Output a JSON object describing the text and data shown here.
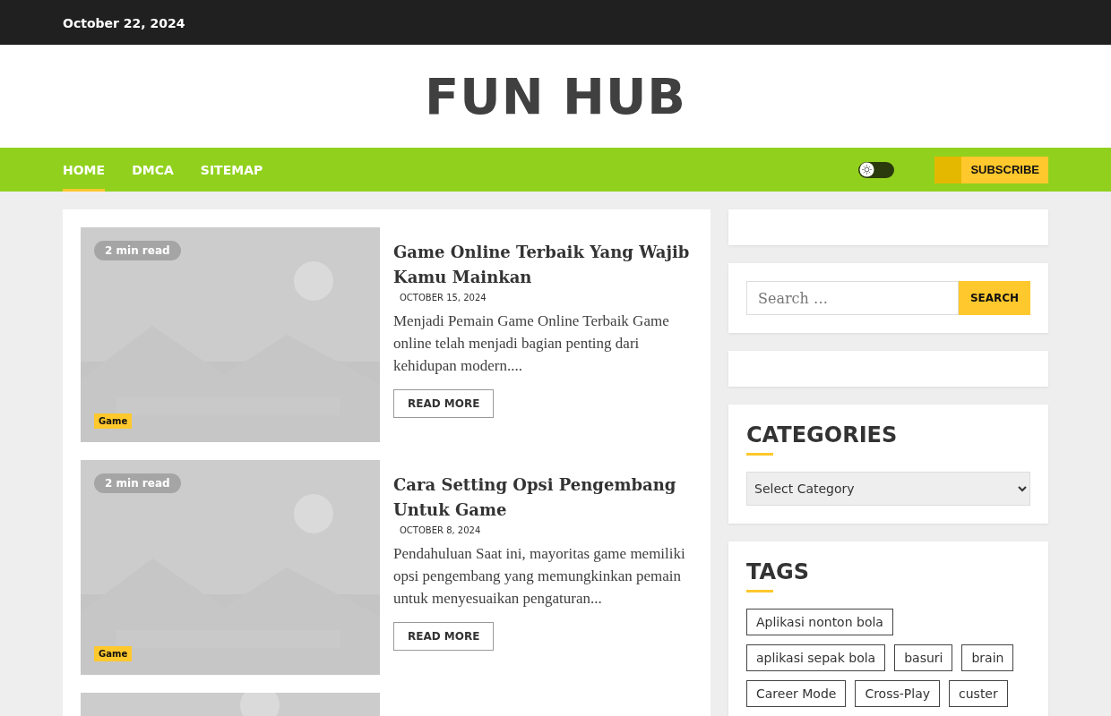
{
  "top_bar": {
    "date": "October 22, 2024"
  },
  "site_title": "FUN HUB",
  "nav": {
    "items": [
      {
        "label": "HOME",
        "selected": true
      },
      {
        "label": "DMCA",
        "selected": false
      },
      {
        "label": "SITEMAP",
        "selected": false
      }
    ],
    "dark_mode": false,
    "subscribe": "SUBSCRIBE"
  },
  "posts": [
    {
      "kind": "article",
      "read_time": "2 min read",
      "category": "Game",
      "title": "Game Online Terbaik Yang Wajib Kamu Mainkan",
      "date": "OCTOBER 15, 2024",
      "excerpt": "Menjadi Pemain Game Online Terbaik Game online telah menjadi bagian penting dari kehidupan modern....",
      "button": "READ MORE"
    },
    {
      "kind": "article",
      "read_time": "2 min read",
      "category": "Game",
      "title": "Cara Setting Opsi Pengembang Untuk Game",
      "date": "OCTOBER 8, 2024",
      "excerpt": "Pendahuluan Saat ini, mayoritas game memiliki opsi pengembang yang memungkinkan pemain untuk menyesuaikan pengaturan...",
      "button": "READ MORE"
    },
    {
      "kind": "picture"
    }
  ],
  "sidebar": {
    "search": {
      "placeholder": "Search …",
      "button": "SEARCH"
    },
    "categories": {
      "title": "CATEGORIES",
      "select": "Select Category"
    },
    "tags": {
      "title": "TAGS",
      "items": [
        "Aplikasi nonton bola",
        "aplikasi sepak bola",
        "basuri",
        "brain",
        "Career Mode",
        "Cross-Play",
        "custer"
      ]
    }
  }
}
